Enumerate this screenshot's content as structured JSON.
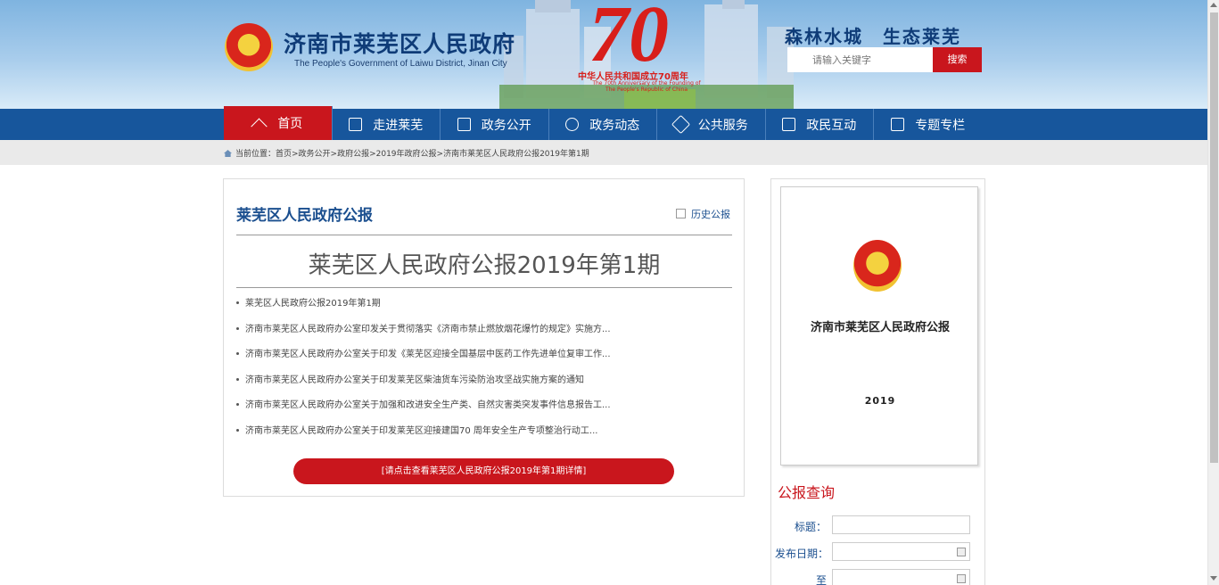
{
  "header": {
    "site_title": "济南市莱芜区人民政府",
    "site_subtitle": "The People's Government of Laiwu District, Jinan City",
    "anniversary_number": "70",
    "anniversary_text": "中华人民共和国成立70周年",
    "anniversary_en": "The 70th Anniversary of the Founding of The People's Republic of China",
    "slogan": "森林水城　生态莱芜",
    "search_placeholder": "请输入关键字",
    "search_button": "搜索"
  },
  "nav": {
    "items": [
      {
        "label": "首页",
        "icon": "home-icon"
      },
      {
        "label": "走进莱芜",
        "icon": "building-icon"
      },
      {
        "label": "政务公开",
        "icon": "document-icon"
      },
      {
        "label": "政务动态",
        "icon": "news-icon"
      },
      {
        "label": "公共服务",
        "icon": "handshake-icon"
      },
      {
        "label": "政民互动",
        "icon": "interaction-icon"
      },
      {
        "label": "专题专栏",
        "icon": "topic-icon"
      }
    ]
  },
  "breadcrumb": {
    "text": "当前位置：首页>政务公开>政府公报>2019年政府公报>济南市莱芜区人民政府公报2019年第1期"
  },
  "main": {
    "heading": "莱芜区人民政府公报",
    "history_link": "历史公报",
    "issue_title": "莱芜区人民政府公报2019年第1期",
    "items": [
      "莱芜区人民政府公报2019年第1期",
      "济南市莱芜区人民政府办公室印发关于贯彻落实《济南市禁止燃放烟花爆竹的规定》实施方...",
      "济南市莱芜区人民政府办公室关于印发《莱芜区迎接全国基层中医药工作先进单位复审工作...",
      "济南市莱芜区人民政府办公室关于印发莱芜区柴油货车污染防治攻坚战实施方案的通知",
      "济南市莱芜区人民政府办公室关于加强和改进安全生产类、自然灾害类突发事件信息报告工...",
      "济南市莱芜区人民政府办公室关于印发莱芜区迎接建国70 周年安全生产专项整治行动工..."
    ],
    "detail_button": "[请点击查看莱芜区人民政府公报2019年第1期详情]"
  },
  "sidebar": {
    "cover_title": "济南市莱芜区人民政府公报",
    "cover_year": "2019",
    "query_title": "公报查询",
    "fields": {
      "title_label": "标题：",
      "date_label": "发布日期：",
      "to_label": "至"
    }
  }
}
